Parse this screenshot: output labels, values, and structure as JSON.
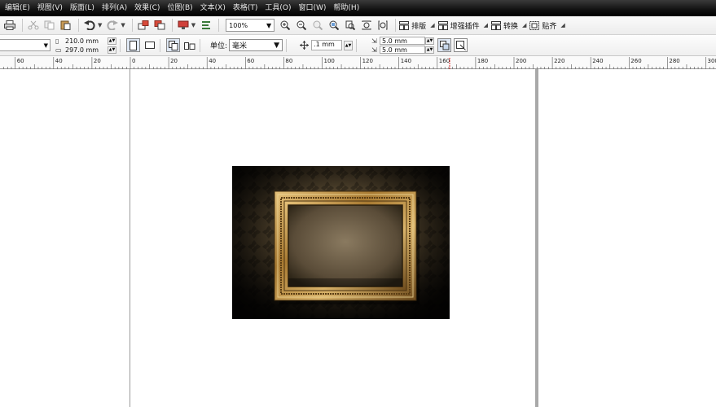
{
  "menu": [
    "编辑(E)",
    "视图(V)",
    "版面(L)",
    "排列(A)",
    "效果(C)",
    "位图(B)",
    "文本(X)",
    "表格(T)",
    "工具(O)",
    "窗口(W)",
    "帮助(H)"
  ],
  "toolbar": {
    "zoom": "100%",
    "text_buttons": [
      "排版",
      "增强插件",
      "转换",
      "贴齐"
    ]
  },
  "propbar": {
    "width": "210.0 mm",
    "height": "297.0 mm",
    "unit_label": "单位:",
    "unit_value": "毫米",
    "nudge": ".1 mm",
    "dup_x": "5.0 mm",
    "dup_y": "5.0 mm"
  },
  "ruler": {
    "labels": [
      "60",
      "40",
      "20",
      "0",
      "20",
      "40",
      "60",
      "80",
      "100",
      "120",
      "140",
      "160",
      "180",
      "200",
      "220",
      "240",
      "260",
      "280",
      "300"
    ]
  },
  "colors": {
    "accent": "#6ea0d8",
    "menubar": "#111111",
    "frame_gold": "#b58a3a"
  }
}
